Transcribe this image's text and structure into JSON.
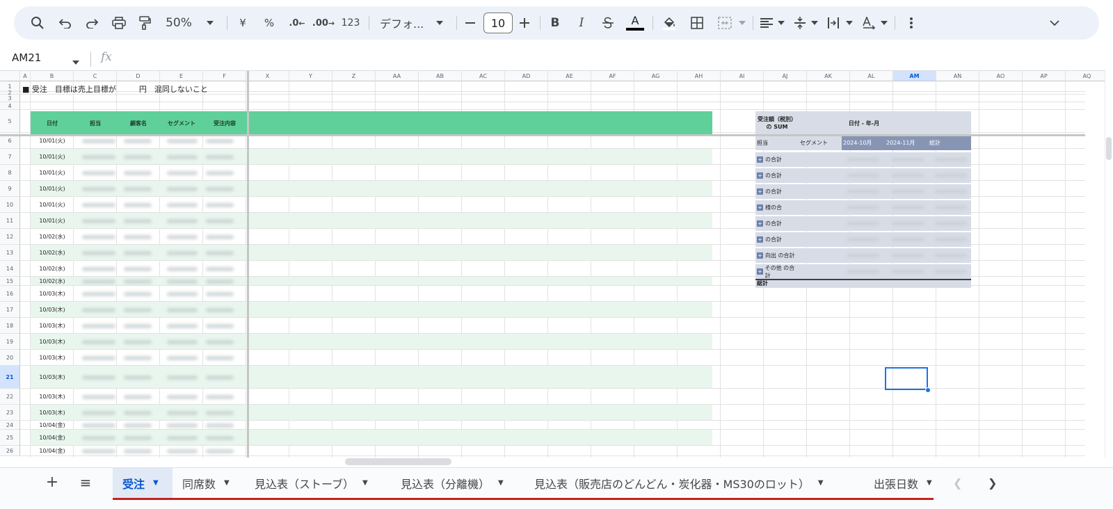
{
  "toolbar": {
    "zoom": "50%",
    "currency": "¥",
    "percent": "%",
    "decrease_decimal": ".0",
    "increase_decimal": ".00",
    "number_format": "123",
    "font_name": "デフォ...",
    "font_size": "10",
    "bold": "B",
    "italic": "I",
    "text_color_letter": "A",
    "colors": {
      "bar_bg": "#edf2fa",
      "icon": "#444746"
    }
  },
  "formula_bar": {
    "name_box": "AM21",
    "fx_label": "fx",
    "value": ""
  },
  "grid": {
    "columns": [
      {
        "label": "A"
      },
      {
        "label": "B"
      },
      {
        "label": "C"
      },
      {
        "label": "D"
      },
      {
        "label": "E"
      },
      {
        "label": "F"
      },
      {
        "label": "X"
      },
      {
        "label": "Y"
      },
      {
        "label": "Z"
      },
      {
        "label": "AA"
      },
      {
        "label": "AB"
      },
      {
        "label": "AC"
      },
      {
        "label": "AD"
      },
      {
        "label": "AE"
      },
      {
        "label": "AF"
      },
      {
        "label": "AG"
      },
      {
        "label": "AH"
      },
      {
        "label": "AI"
      },
      {
        "label": "AJ"
      },
      {
        "label": "AK"
      },
      {
        "label": "AL"
      },
      {
        "label": "AM"
      },
      {
        "label": "AN"
      },
      {
        "label": "AO"
      },
      {
        "label": "AP"
      },
      {
        "label": "AQ"
      }
    ],
    "selected_column": "AM",
    "selected_row": "21",
    "rows": [
      "1",
      "2",
      "3",
      "4",
      "5",
      "6",
      "7",
      "8",
      "9",
      "10",
      "11",
      "12",
      "13",
      "14",
      "15",
      "16",
      "17",
      "18",
      "19",
      "20",
      "21",
      "22",
      "23",
      "24",
      "25",
      "26"
    ],
    "title": "■ 受注　目標は売上目標が　　　円　混同しないこと",
    "headers": {
      "date": "日付",
      "person": "担当",
      "customer": "顧客名",
      "segment": "セグメント",
      "order": "受注内容"
    },
    "dates": [
      "10/01(火)",
      "10/01(火)",
      "10/01(火)",
      "10/01(火)",
      "10/01(火)",
      "10/01(火)",
      "10/02(水)",
      "10/02(水)",
      "10/02(水)",
      "10/02(水)",
      "10/03(木)",
      "10/03(木)",
      "10/03(木)",
      "10/03(木)",
      "10/03(木)",
      "10/03(木)",
      "10/03(木)",
      "10/03(木)",
      "10/04(金)",
      "10/04(金)",
      "10/04(金)"
    ]
  },
  "pivot": {
    "value_header": "受注額（税別）の SUM",
    "column_header": "日付 - 年-月",
    "row_header_person": "担当",
    "row_header_segment": "セグメント",
    "col_2024_10": "2024-10月",
    "col_2024_11": "2024-11月",
    "col_total": "総計",
    "rows": [
      {
        "label": "の合計"
      },
      {
        "label": "の合計"
      },
      {
        "label": "の合計"
      },
      {
        "label": "様の合"
      },
      {
        "label": "の合計"
      },
      {
        "label": "の合計"
      },
      {
        "label": "向出 の合計"
      },
      {
        "label": "その他 の合計"
      }
    ],
    "grand_total": "総計"
  },
  "sheets": {
    "add_label": "+",
    "list_label": "≡",
    "tabs": [
      {
        "label": "受注"
      },
      {
        "label": "同席数"
      },
      {
        "label": "見込表（ストーブ）"
      },
      {
        "label": "見込表（分離機）"
      },
      {
        "label": "見込表（販売店のどんどん・炭化器・MS30のロット）"
      },
      {
        "label": "出張日数"
      }
    ]
  }
}
